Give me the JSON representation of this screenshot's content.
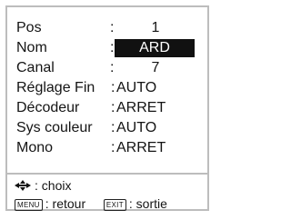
{
  "menu": {
    "rows": [
      {
        "label": "Pos",
        "value": "1"
      },
      {
        "label": "Nom",
        "value": "ARD"
      },
      {
        "label": "Canal",
        "value": "7"
      },
      {
        "label": "Réglage Fin",
        "value": "AUTO"
      },
      {
        "label": "Décodeur",
        "value": "ARRET"
      },
      {
        "label": "Sys couleur",
        "value": "AUTO"
      },
      {
        "label": "Mono",
        "value": "ARRET"
      }
    ],
    "colon": ":"
  },
  "footer": {
    "choice_text": ": choix",
    "menu_key": "MENU",
    "back_text": ": retour",
    "exit_key": "EXIT",
    "exit_text": ": sortie"
  },
  "icons": {
    "navigate": "four-arrow-icon"
  },
  "colors": {
    "selection_bg": "#111111",
    "selection_fg": "#ffffff",
    "border": "#bdbdbd"
  }
}
